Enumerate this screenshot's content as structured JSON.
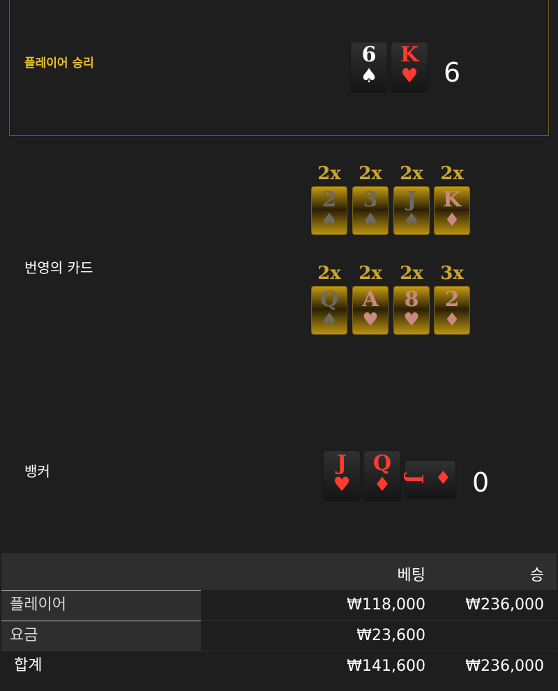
{
  "result": {
    "title": "플레이어 승리"
  },
  "player": {
    "cards": [
      {
        "rank": "6",
        "suit": "♠",
        "color": "black"
      },
      {
        "rank": "K",
        "suit": "♥",
        "color": "red"
      }
    ],
    "score": "6"
  },
  "lucky": {
    "label": "번영의 카드",
    "cards": [
      {
        "mult": "2x",
        "rank": "2",
        "suit": "♠",
        "color": "black"
      },
      {
        "mult": "2x",
        "rank": "3",
        "suit": "♠",
        "color": "black"
      },
      {
        "mult": "2x",
        "rank": "J",
        "suit": "♠",
        "color": "black"
      },
      {
        "mult": "2x",
        "rank": "K",
        "suit": "♦",
        "color": "red"
      },
      {
        "mult": "2x",
        "rank": "Q",
        "suit": "♠",
        "color": "black"
      },
      {
        "mult": "2x",
        "rank": "A",
        "suit": "♥",
        "color": "red"
      },
      {
        "mult": "2x",
        "rank": "8",
        "suit": "♥",
        "color": "red"
      },
      {
        "mult": "3x",
        "rank": "2",
        "suit": "♦",
        "color": "red"
      }
    ]
  },
  "banker": {
    "label": "뱅커",
    "cards": [
      {
        "rank": "J",
        "suit": "♥",
        "color": "red"
      },
      {
        "rank": "Q",
        "suit": "♦",
        "color": "red"
      },
      {
        "rank": "J",
        "suit": "♦",
        "color": "red"
      }
    ],
    "score": "0"
  },
  "table": {
    "header": {
      "bet": "베팅",
      "win": "승"
    },
    "rows": [
      {
        "name": "플레이어",
        "bet": "₩118,000",
        "win": "₩236,000"
      },
      {
        "name": "요금",
        "bet": "₩23,600",
        "win": ""
      }
    ],
    "total": {
      "name": "합계",
      "bet": "₩141,600",
      "win": "₩236,000"
    }
  },
  "colors": {
    "gold_text": "#e8c12a",
    "red_suit": "#ff3b30",
    "bg": "#1e1e1e"
  }
}
